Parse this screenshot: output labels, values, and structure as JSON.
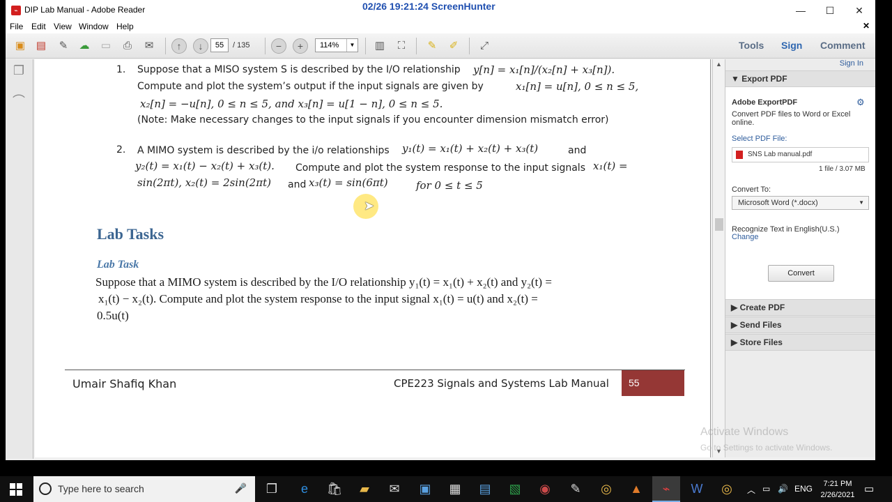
{
  "window": {
    "title": "DIP Lab Manual - Adobe Reader",
    "overlay": "02/26  19:21:24  ScreenHunter"
  },
  "menu": [
    "File",
    "Edit",
    "View",
    "Window",
    "Help"
  ],
  "toolbar": {
    "page_current": "55",
    "page_total": "/ 135",
    "zoom": "114%",
    "tools": "Tools",
    "sign": "Sign",
    "comment": "Comment"
  },
  "document": {
    "item1_num": "1.",
    "item1_l1_text": "Suppose that a MISO system S is described by the I/O relationship",
    "item1_l1_math": "y[n] = x₁[n]/(x₂[n] + x₃[n]).",
    "item1_l2_text": "Compute and plot the system’s output if the input signals are given by",
    "item1_l2_math": "x₁[n] = u[n], 0 ≤ n ≤ 5,",
    "item1_l3": "x₂[n] = −u[n], 0 ≤ n ≤ 5, and x₃[n] = u[1 − n], 0 ≤ n ≤ 5.",
    "item1_l4": "(Note: Make necessary changes to the input signals if you encounter dimension mismatch error)",
    "item2_num": "2.",
    "item2_l1_text": "A MIMO system is described by the i/o relationships",
    "item2_l1_math": "y₁(t) =   x₁(t) + x₂(t) + x₃(t)",
    "item2_l1_and": "and",
    "item2_l2_math": "y₂(t) = x₁(t) − x₂(t) + x₃(t).",
    "item2_l2_text": "Compute and plot the system response to the input signals",
    "item2_l2_math2": "x₁(t) =",
    "item2_l3_math": "sin(2πt), x₂(t) = 2sin(2πt)",
    "item2_l3_and": "and",
    "item2_l3_math2": "x₃(t) = sin(6πt)",
    "item2_l3_for": "for 0 ≤ t ≤ 5",
    "lab_tasks_heading": "Lab Tasks",
    "lab_task_subheading": "Lab Task",
    "task_l1": "Suppose that a MIMO system is described by the I/O relationship y₁(t) = x₁(t) + x₂(t) and y₂(t) =",
    "task_l2": "x₁(t) − x₂(t). Compute and plot the system response to the input signal x₁(t) = u(t) and x₂(t) =",
    "task_l3": "0.5u(t)",
    "footer_left": "Umair Shafiq Khan",
    "footer_right": "CPE223 Signals and Systems Lab Manual",
    "footer_page": "55"
  },
  "right_panel": {
    "sign_in": "Sign In",
    "export_pdf": "Export PDF",
    "adobe_exportpdf": "Adobe ExportPDF",
    "description": "Convert PDF files to Word or Excel",
    "description2": "online.",
    "select_pdf": "Select PDF File:",
    "file_name": "SNS Lab manual.pdf",
    "file_count": "1 file / 3.07 MB",
    "convert_to": "Convert To:",
    "convert_option": "Microsoft Word (*.docx)",
    "recognize": "Recognize Text in English(U.S.)",
    "change": "Change",
    "convert_button": "Convert",
    "create_pdf": "Create PDF",
    "send_files": "Send Files",
    "store_files": "Store Files"
  },
  "watermark": {
    "line1": "Activate Windows",
    "line2": "Go to Settings to activate Windows."
  },
  "taskbar": {
    "search_placeholder": "Type here to search",
    "language": "ENG",
    "time": "7:21 PM",
    "date": "2/26/2021"
  }
}
